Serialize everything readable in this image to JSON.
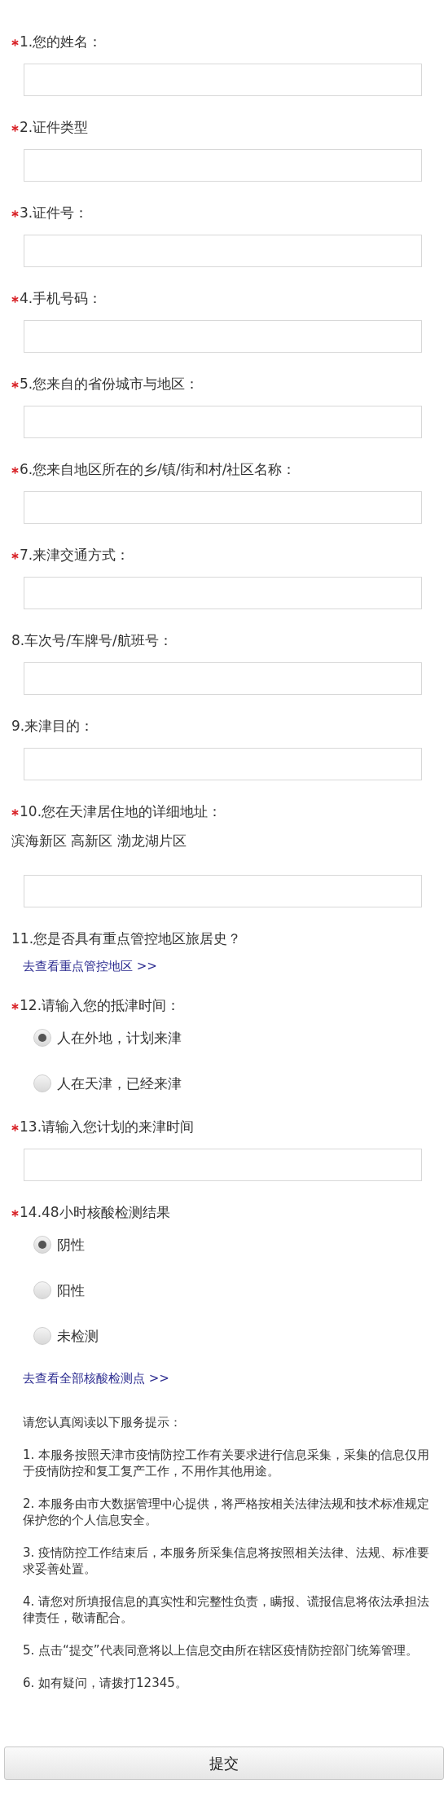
{
  "questions": [
    {
      "required": true,
      "label": "1.您的姓名：",
      "kind": "input"
    },
    {
      "required": true,
      "label": "2.证件类型",
      "kind": "input"
    },
    {
      "required": true,
      "label": "3.证件号：",
      "kind": "input"
    },
    {
      "required": true,
      "label": "4.手机号码：",
      "kind": "input"
    },
    {
      "required": true,
      "label": "5.您来自的省份城市与地区：",
      "kind": "input"
    },
    {
      "required": true,
      "label": "6.您来自地区所在的乡/镇/街和村/社区名称：",
      "kind": "input"
    },
    {
      "required": true,
      "label": "7.来津交通方式：",
      "kind": "input"
    },
    {
      "required": false,
      "label": "8.车次号/车牌号/航班号：",
      "kind": "input"
    },
    {
      "required": false,
      "label": "9.来津目的：",
      "kind": "input"
    },
    {
      "required": true,
      "label": "10.您在天津居住地的详细地址：",
      "note": "滨海新区 高新区 渤龙湖片区",
      "kind": "input"
    },
    {
      "required": false,
      "label": "11.您是否具有重点管控地区旅居史？",
      "kind": "text",
      "link": "去查看重点管控地区 >>"
    },
    {
      "required": true,
      "label": "12.请输入您的抵津时间：",
      "kind": "radio",
      "options": [
        {
          "label": "人在外地，计划来津",
          "selected": true
        },
        {
          "label": "人在天津，已经来津",
          "selected": false
        }
      ]
    },
    {
      "required": true,
      "label": "13.请输入您计划的来津时间",
      "kind": "input"
    },
    {
      "required": true,
      "label": "14.48小时核酸检测结果",
      "kind": "radio",
      "options": [
        {
          "label": "阴性",
          "selected": true
        },
        {
          "label": "阳性",
          "selected": false
        },
        {
          "label": "未检测",
          "selected": false
        }
      ],
      "link": "去查看全部核酸检测点 >>"
    }
  ],
  "notice": {
    "intro": "请您认真阅读以下服务提示：",
    "items": [
      "1. 本服务按照天津市疫情防控工作有关要求进行信息采集，采集的信息仅用于疫情防控和复工复产工作，不用作其他用途。",
      "2. 本服务由市大数据管理中心提供，将严格按相关法律法规和技术标准规定保护您的个人信息安全。",
      "3. 疫情防控工作结束后，本服务所采集信息将按照相关法律、法规、标准要求妥善处置。",
      "4. 请您对所填报信息的真实性和完整性负责，瞒报、谎报信息将依法承担法律责任，敬请配合。",
      "5. 点击“提交”代表同意将以上信息交由所在辖区疫情防控部门统筹管理。",
      "6. 如有疑问，请拨打12345。"
    ]
  },
  "submit": "提交"
}
